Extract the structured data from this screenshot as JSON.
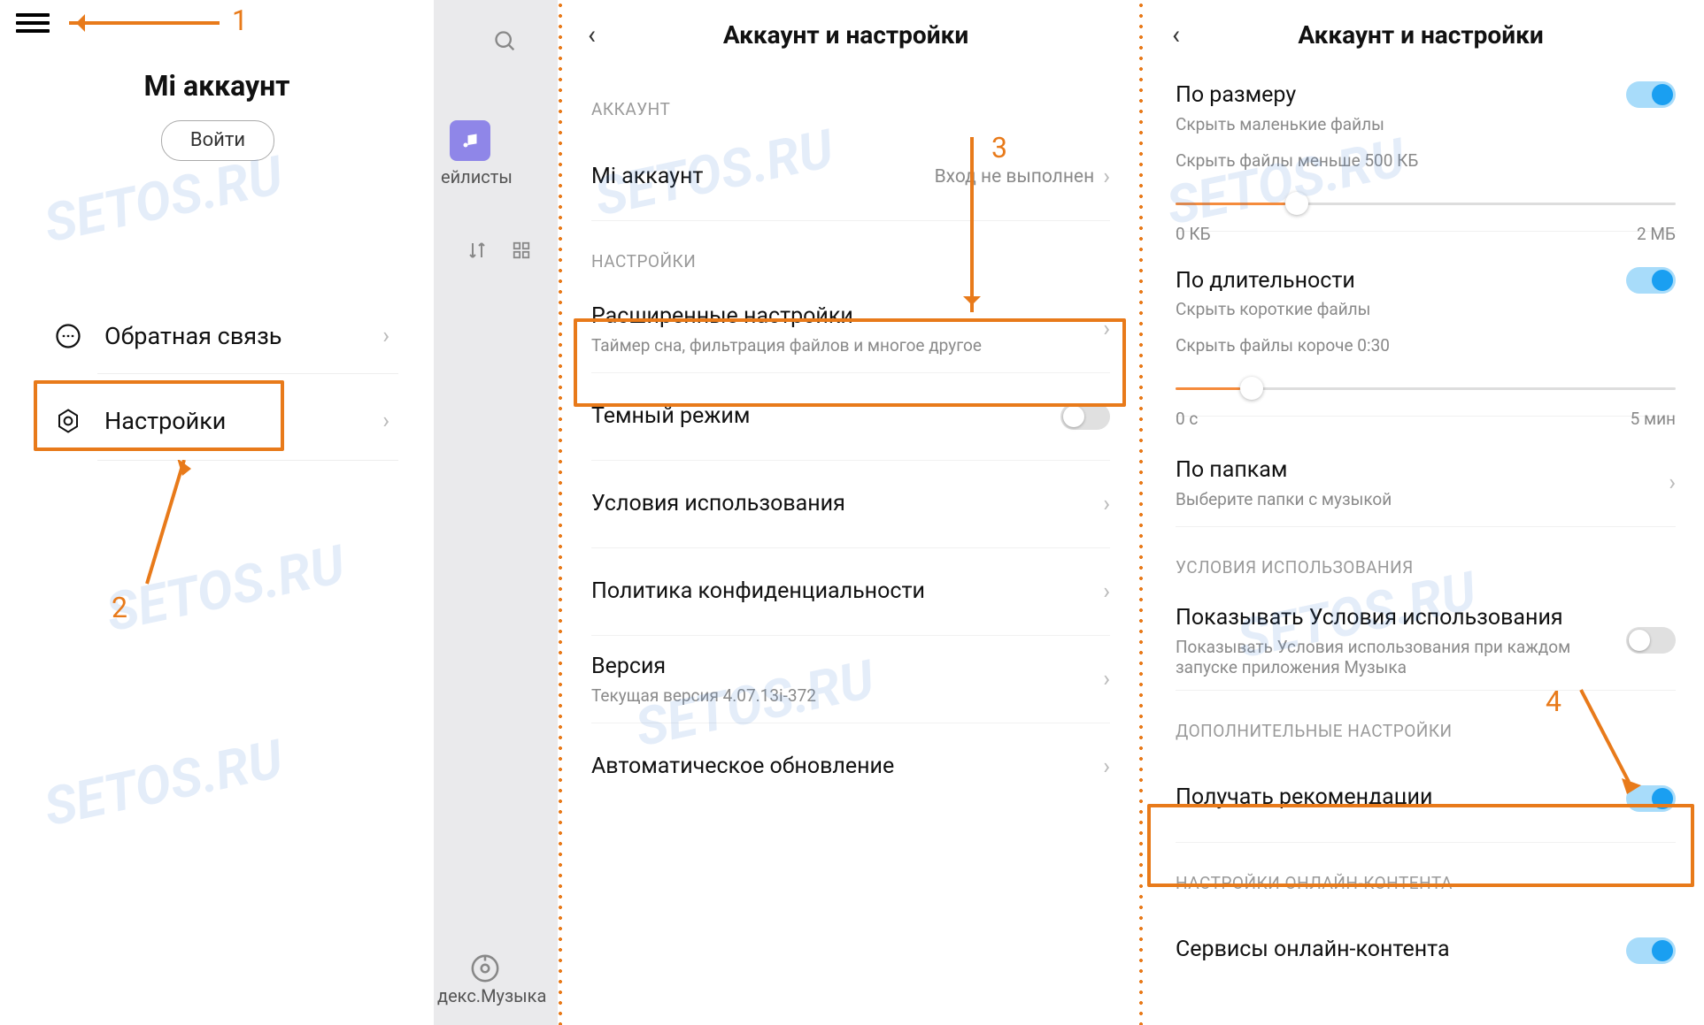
{
  "panel1": {
    "title": "Mi аккаунт",
    "login": "Войти",
    "feedback": "Обратная связь",
    "settings": "Настройки",
    "bg_playlists": "ейлисты",
    "bg_yandex": "декс.Музыка",
    "anno1": "1",
    "anno2": "2"
  },
  "panel2": {
    "header": "Аккаунт и настройки",
    "grp_account": "АККАУНТ",
    "mi_account": "Mi аккаунт",
    "mi_status": "Вход не выполнен",
    "grp_settings": "НАСТРОЙКИ",
    "adv_title": "Расширенные настройки",
    "adv_sub": "Таймер сна, фильтрация файлов и многое другое",
    "dark": "Темный режим",
    "terms": "Условия использования",
    "privacy": "Политика конфиденциальности",
    "version": "Версия",
    "version_sub": "Текущая версия 4.07.13i-372",
    "auto_update": "Автоматическое обновление",
    "anno3": "3"
  },
  "panel3": {
    "header": "Аккаунт и настройки",
    "by_size": "По размеру",
    "by_size_sub": "Скрыть маленькие файлы",
    "size_label": "Скрыть файлы меньше 500 КБ",
    "size_min": "0 КБ",
    "size_max": "2 МБ",
    "by_duration": "По длительности",
    "by_duration_sub": "Скрыть короткие файлы",
    "dur_label": "Скрыть файлы короче 0:30",
    "dur_min": "0 с",
    "dur_max": "5 мин",
    "by_folder": "По папкам",
    "by_folder_sub": "Выберите папки с музыкой",
    "grp_terms": "УСЛОВИЯ ИСПОЛЬЗОВАНИЯ",
    "show_terms": "Показывать Условия использования",
    "show_terms_sub": "Показывать Условия использования при каждом запуске приложения Музыка",
    "grp_extra": "ДОПОЛНИТЕЛЬНЫЕ НАСТРОЙКИ",
    "recommend": "Получать рекомендации",
    "grp_online": "НАСТРОЙКИ ОНЛАЙН-КОНТЕНТА",
    "online_services": "Сервисы онлайн-контента",
    "anno4": "4"
  }
}
